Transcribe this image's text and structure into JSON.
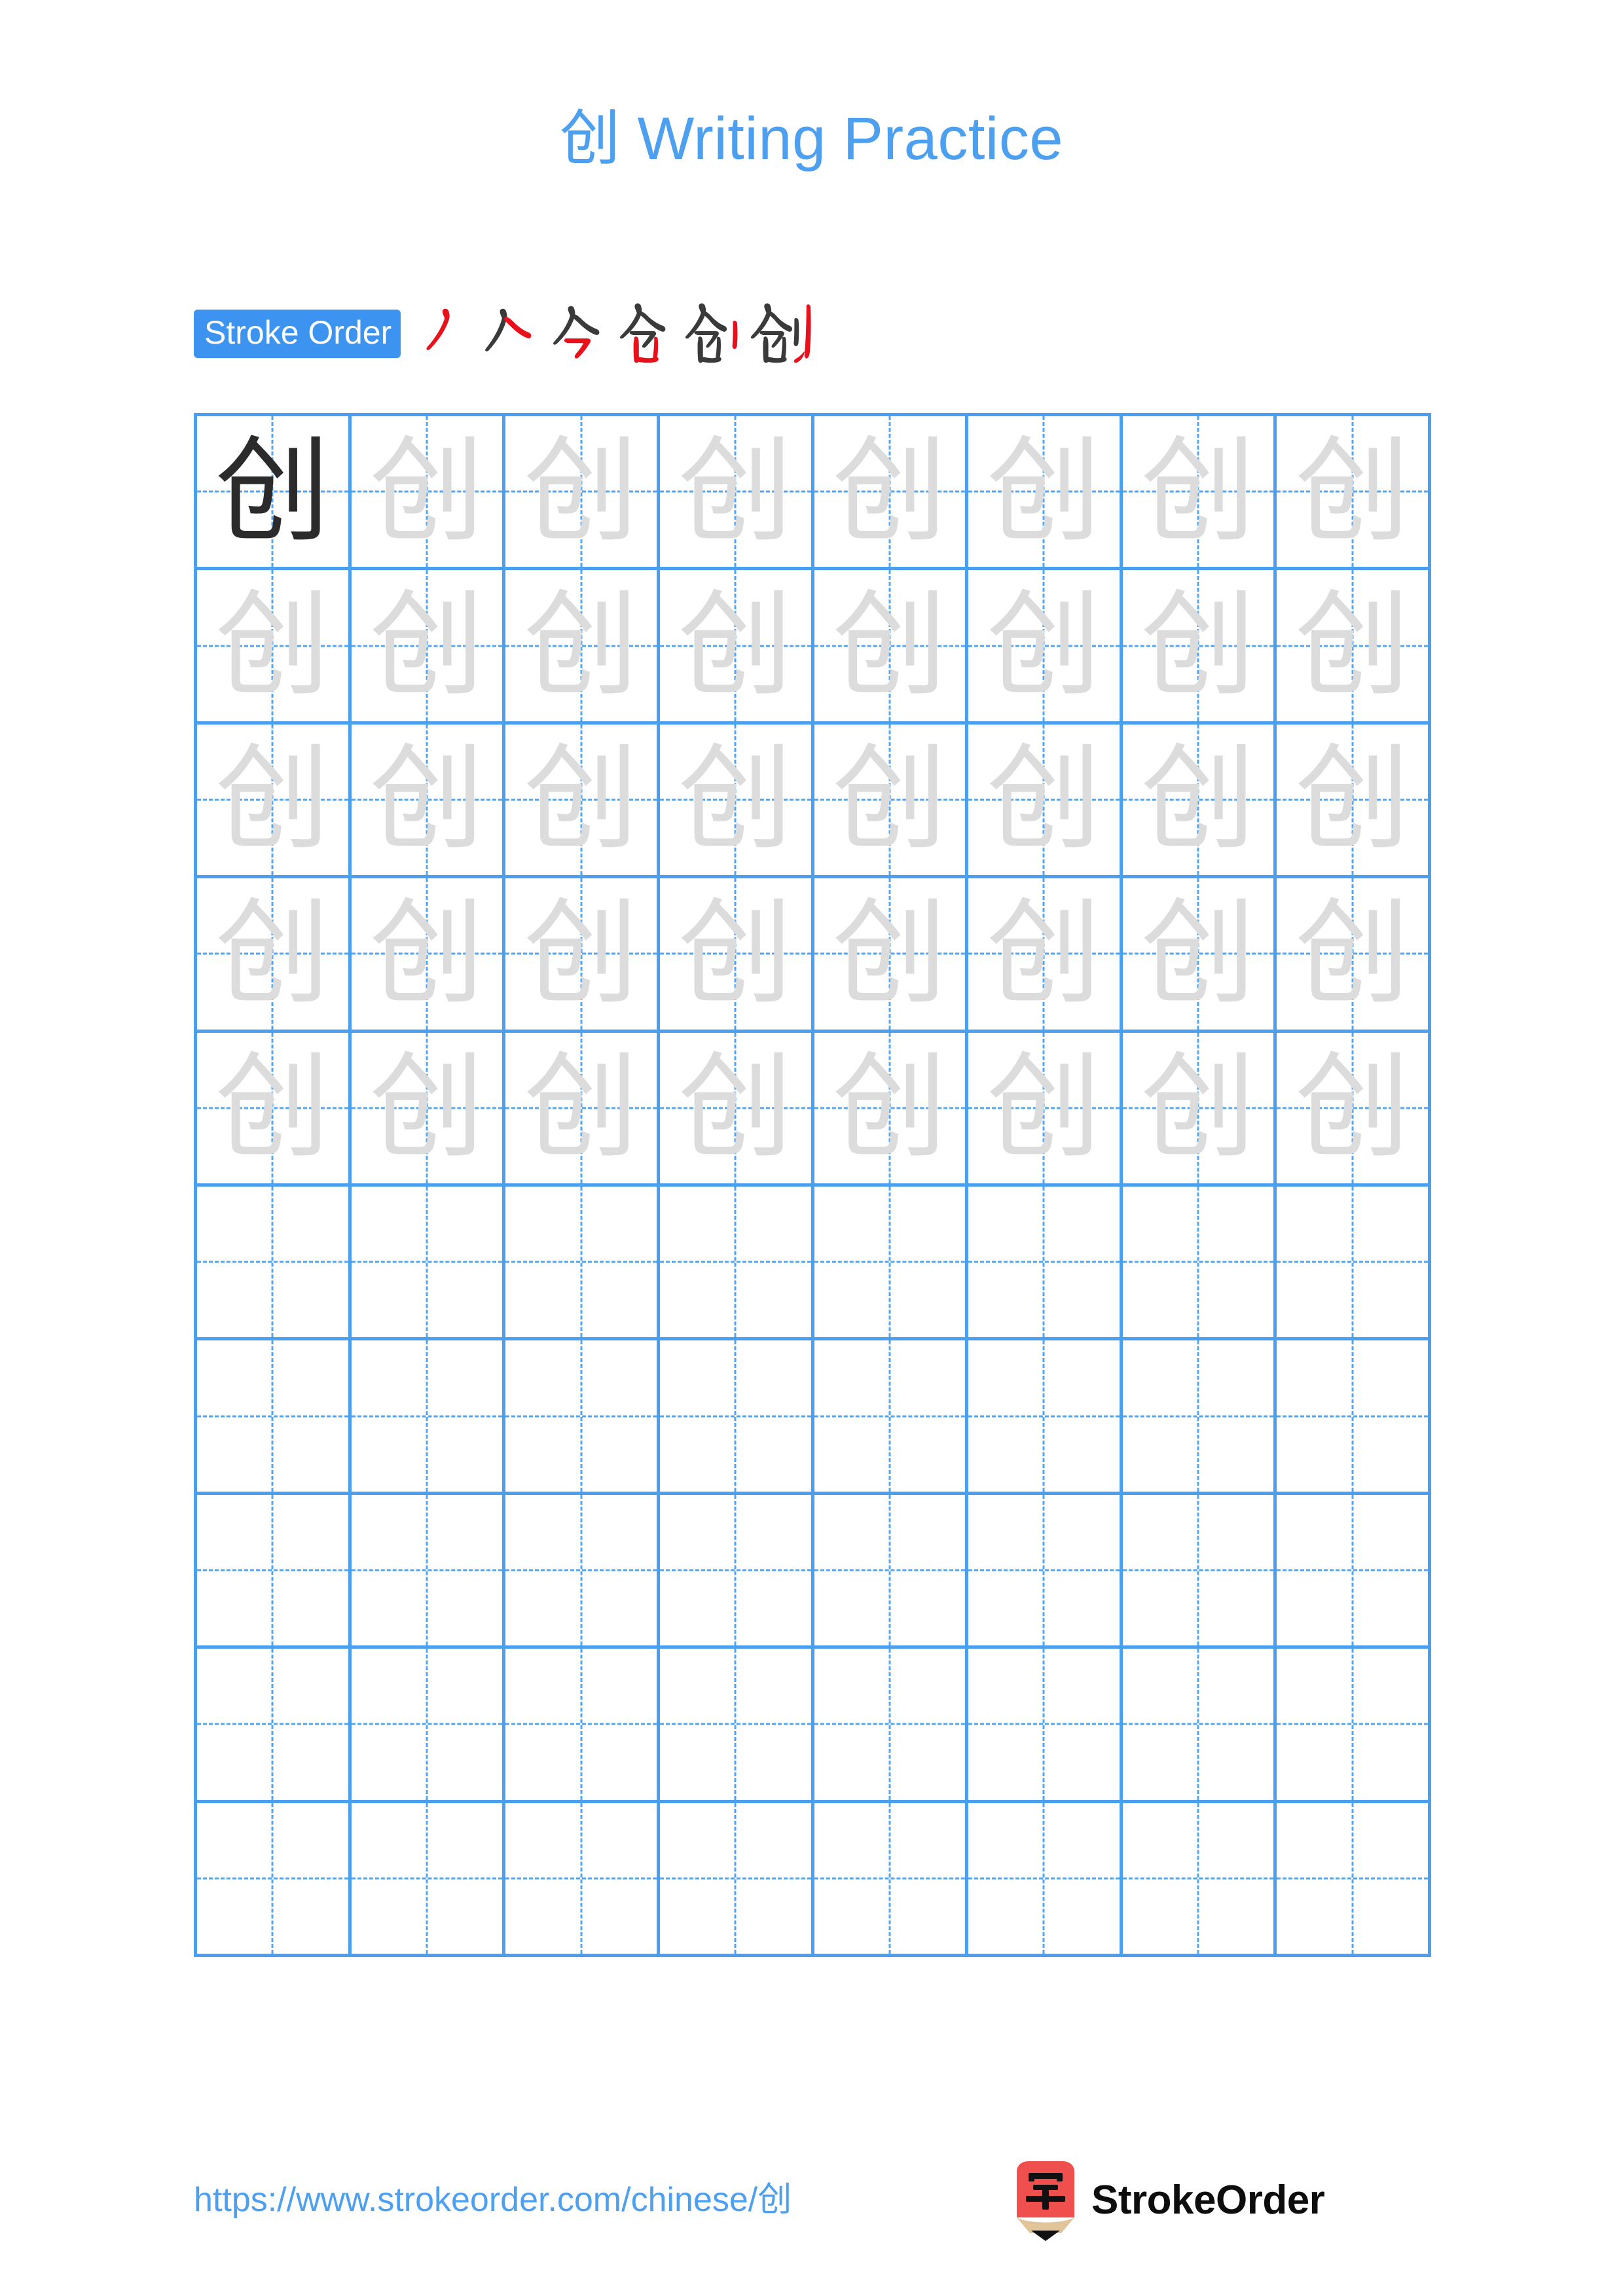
{
  "document": {
    "character": "创",
    "title": "创 Writing Practice",
    "background_color": "#ffffff"
  },
  "theme": {
    "accent_blue": "#4a9ff0",
    "title_blue": "#4d9ff0",
    "badge_blue": "#3d94f0",
    "grid_line": "#4a9ff0",
    "guide_dash": "#53a5f2",
    "model_char": "#2b2b2b",
    "trace_char": "#dcdcdc",
    "stroke_new": "#e8111b",
    "stroke_done": "#3a3a3a",
    "logo_red": "#f0504d",
    "logo_wood": "#e2c49b",
    "logo_tip": "#111111"
  },
  "stroke_order": {
    "label": "Stroke Order",
    "total_strokes": 6,
    "steps": [
      {
        "index": 1,
        "name": "stroke-step-1"
      },
      {
        "index": 2,
        "name": "stroke-step-2"
      },
      {
        "index": 3,
        "name": "stroke-step-3"
      },
      {
        "index": 4,
        "name": "stroke-step-4"
      },
      {
        "index": 5,
        "name": "stroke-step-5"
      },
      {
        "index": 6,
        "name": "stroke-step-6"
      }
    ]
  },
  "grid": {
    "columns": 8,
    "rows": 10,
    "character": "创",
    "model_cell": {
      "row": 1,
      "column": 1
    },
    "filled_rows": 5,
    "empty_rows": 5,
    "row_fill": [
      [
        "model",
        "trace",
        "trace",
        "trace",
        "trace",
        "trace",
        "trace",
        "trace"
      ],
      [
        "trace",
        "trace",
        "trace",
        "trace",
        "trace",
        "trace",
        "trace",
        "trace"
      ],
      [
        "trace",
        "trace",
        "trace",
        "trace",
        "trace",
        "trace",
        "trace",
        "trace"
      ],
      [
        "trace",
        "trace",
        "trace",
        "trace",
        "trace",
        "trace",
        "trace",
        "trace"
      ],
      [
        "trace",
        "trace",
        "trace",
        "trace",
        "trace",
        "trace",
        "trace",
        "trace"
      ],
      [
        "empty",
        "empty",
        "empty",
        "empty",
        "empty",
        "empty",
        "empty",
        "empty"
      ],
      [
        "empty",
        "empty",
        "empty",
        "empty",
        "empty",
        "empty",
        "empty",
        "empty"
      ],
      [
        "empty",
        "empty",
        "empty",
        "empty",
        "empty",
        "empty",
        "empty",
        "empty"
      ],
      [
        "empty",
        "empty",
        "empty",
        "empty",
        "empty",
        "empty",
        "empty",
        "empty"
      ],
      [
        "empty",
        "empty",
        "empty",
        "empty",
        "empty",
        "empty",
        "empty",
        "empty"
      ]
    ]
  },
  "footer": {
    "url": "https://www.strokeorder.com/chinese/创",
    "brand_name": "StrokeOrder",
    "logo_character": "字"
  }
}
